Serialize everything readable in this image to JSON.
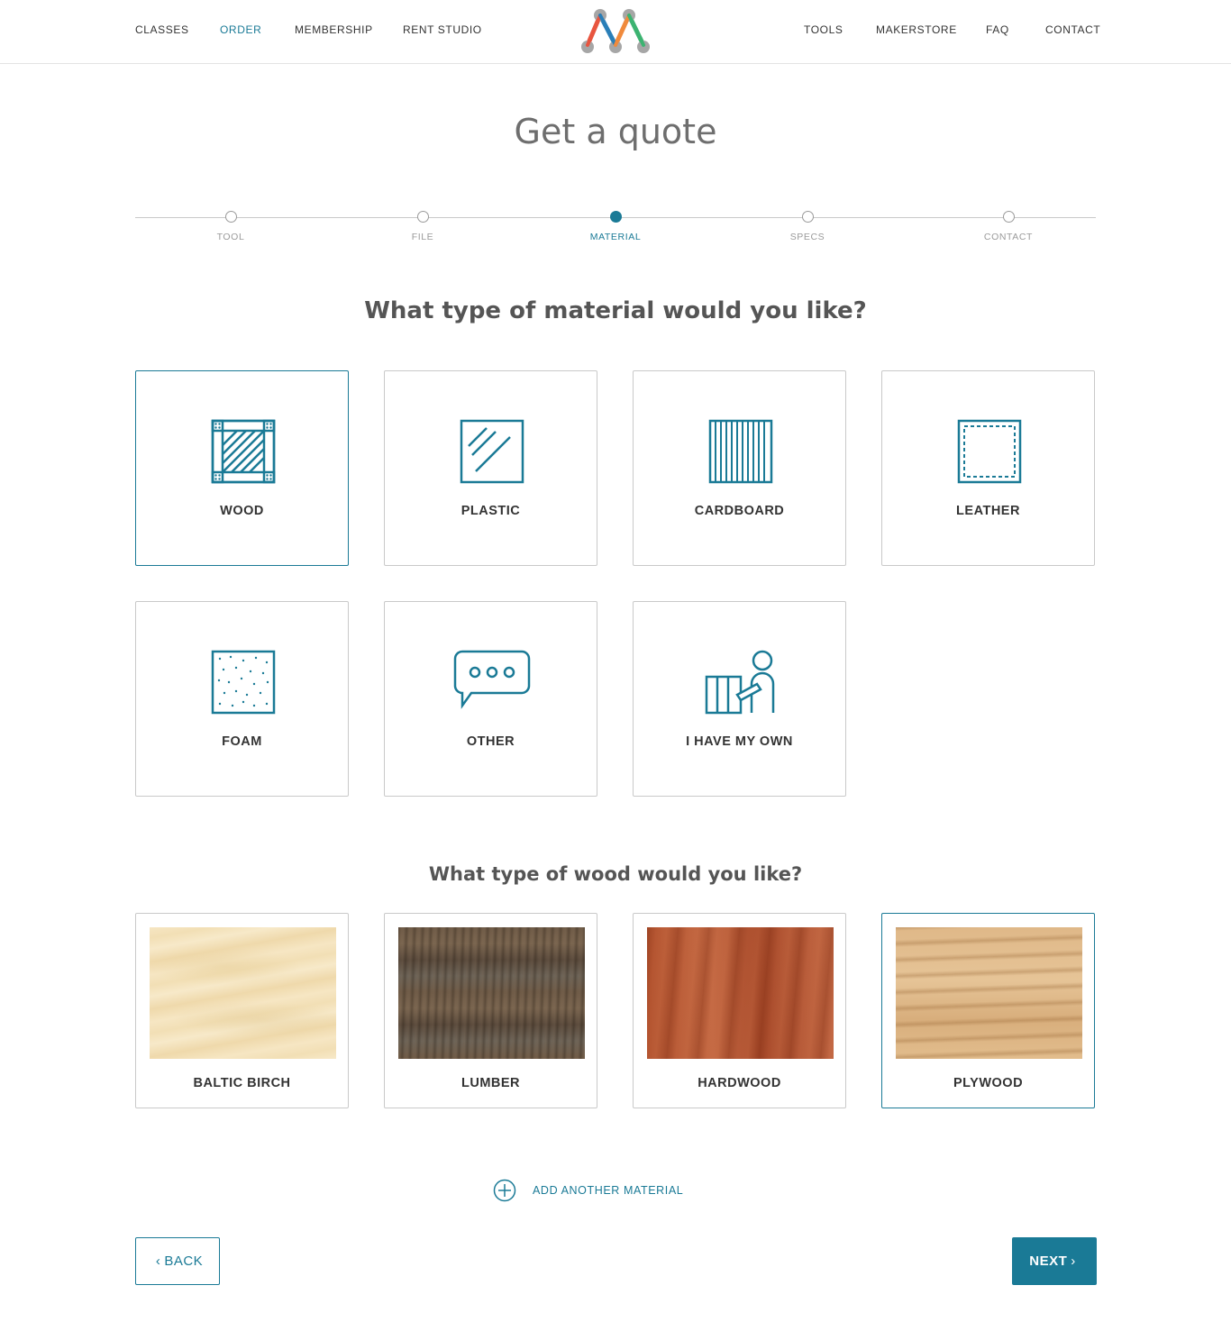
{
  "nav": {
    "left": [
      "CLASSES",
      "ORDER",
      "MEMBERSHIP",
      "RENT STUDIO"
    ],
    "right": [
      "TOOLS",
      "MAKERSTORE",
      "FAQ",
      "CONTACT"
    ],
    "active": "ORDER"
  },
  "page": {
    "title": "Get a quote"
  },
  "stepper": {
    "steps": [
      "TOOL",
      "FILE",
      "MATERIAL",
      "SPECS",
      "CONTACT"
    ],
    "active_step": "MATERIAL"
  },
  "material": {
    "question": "What type of material would you like?",
    "options": [
      "WOOD",
      "PLASTIC",
      "CARDBOARD",
      "LEATHER",
      "FOAM",
      "OTHER",
      "I HAVE MY OWN"
    ],
    "selected": "WOOD"
  },
  "wood": {
    "question": "What type of wood would you like?",
    "options": [
      "BALTIC BIRCH",
      "LUMBER",
      "HARDWOOD",
      "PLYWOOD"
    ],
    "selected": "PLYWOOD"
  },
  "add_material": {
    "label": "ADD ANOTHER MATERIAL"
  },
  "buttons": {
    "back": "BACK",
    "next": "NEXT"
  },
  "colors": {
    "accent": "#1a7a96",
    "logo_red": "#e8553f",
    "logo_blue": "#2a7fb8",
    "logo_green": "#3cb371",
    "logo_orange": "#f08a3c",
    "logo_gray": "#a6a6a6"
  }
}
